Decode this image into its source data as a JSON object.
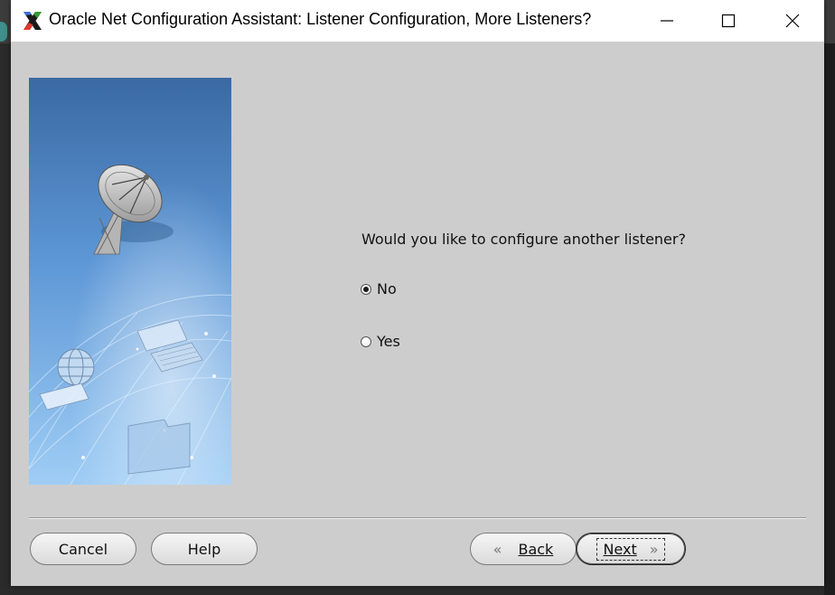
{
  "window": {
    "title": "Oracle Net Configuration Assistant: Listener Configuration, More Listeners?",
    "icon": "oracle-x-icon",
    "controls": [
      "minimize-icon",
      "maximize-icon",
      "close-icon"
    ]
  },
  "sidebar_image": {
    "description_icons": [
      "satellite-dish-icon",
      "globe-icon",
      "laptop-icon",
      "folder-icon"
    ]
  },
  "question": {
    "text": "Would you like to configure another listener?"
  },
  "options": [
    {
      "label": "No",
      "selected": true
    },
    {
      "label": "Yes",
      "selected": false
    }
  ],
  "buttons": {
    "cancel": "Cancel",
    "help": "Help",
    "back": "Back",
    "next": "Next"
  }
}
